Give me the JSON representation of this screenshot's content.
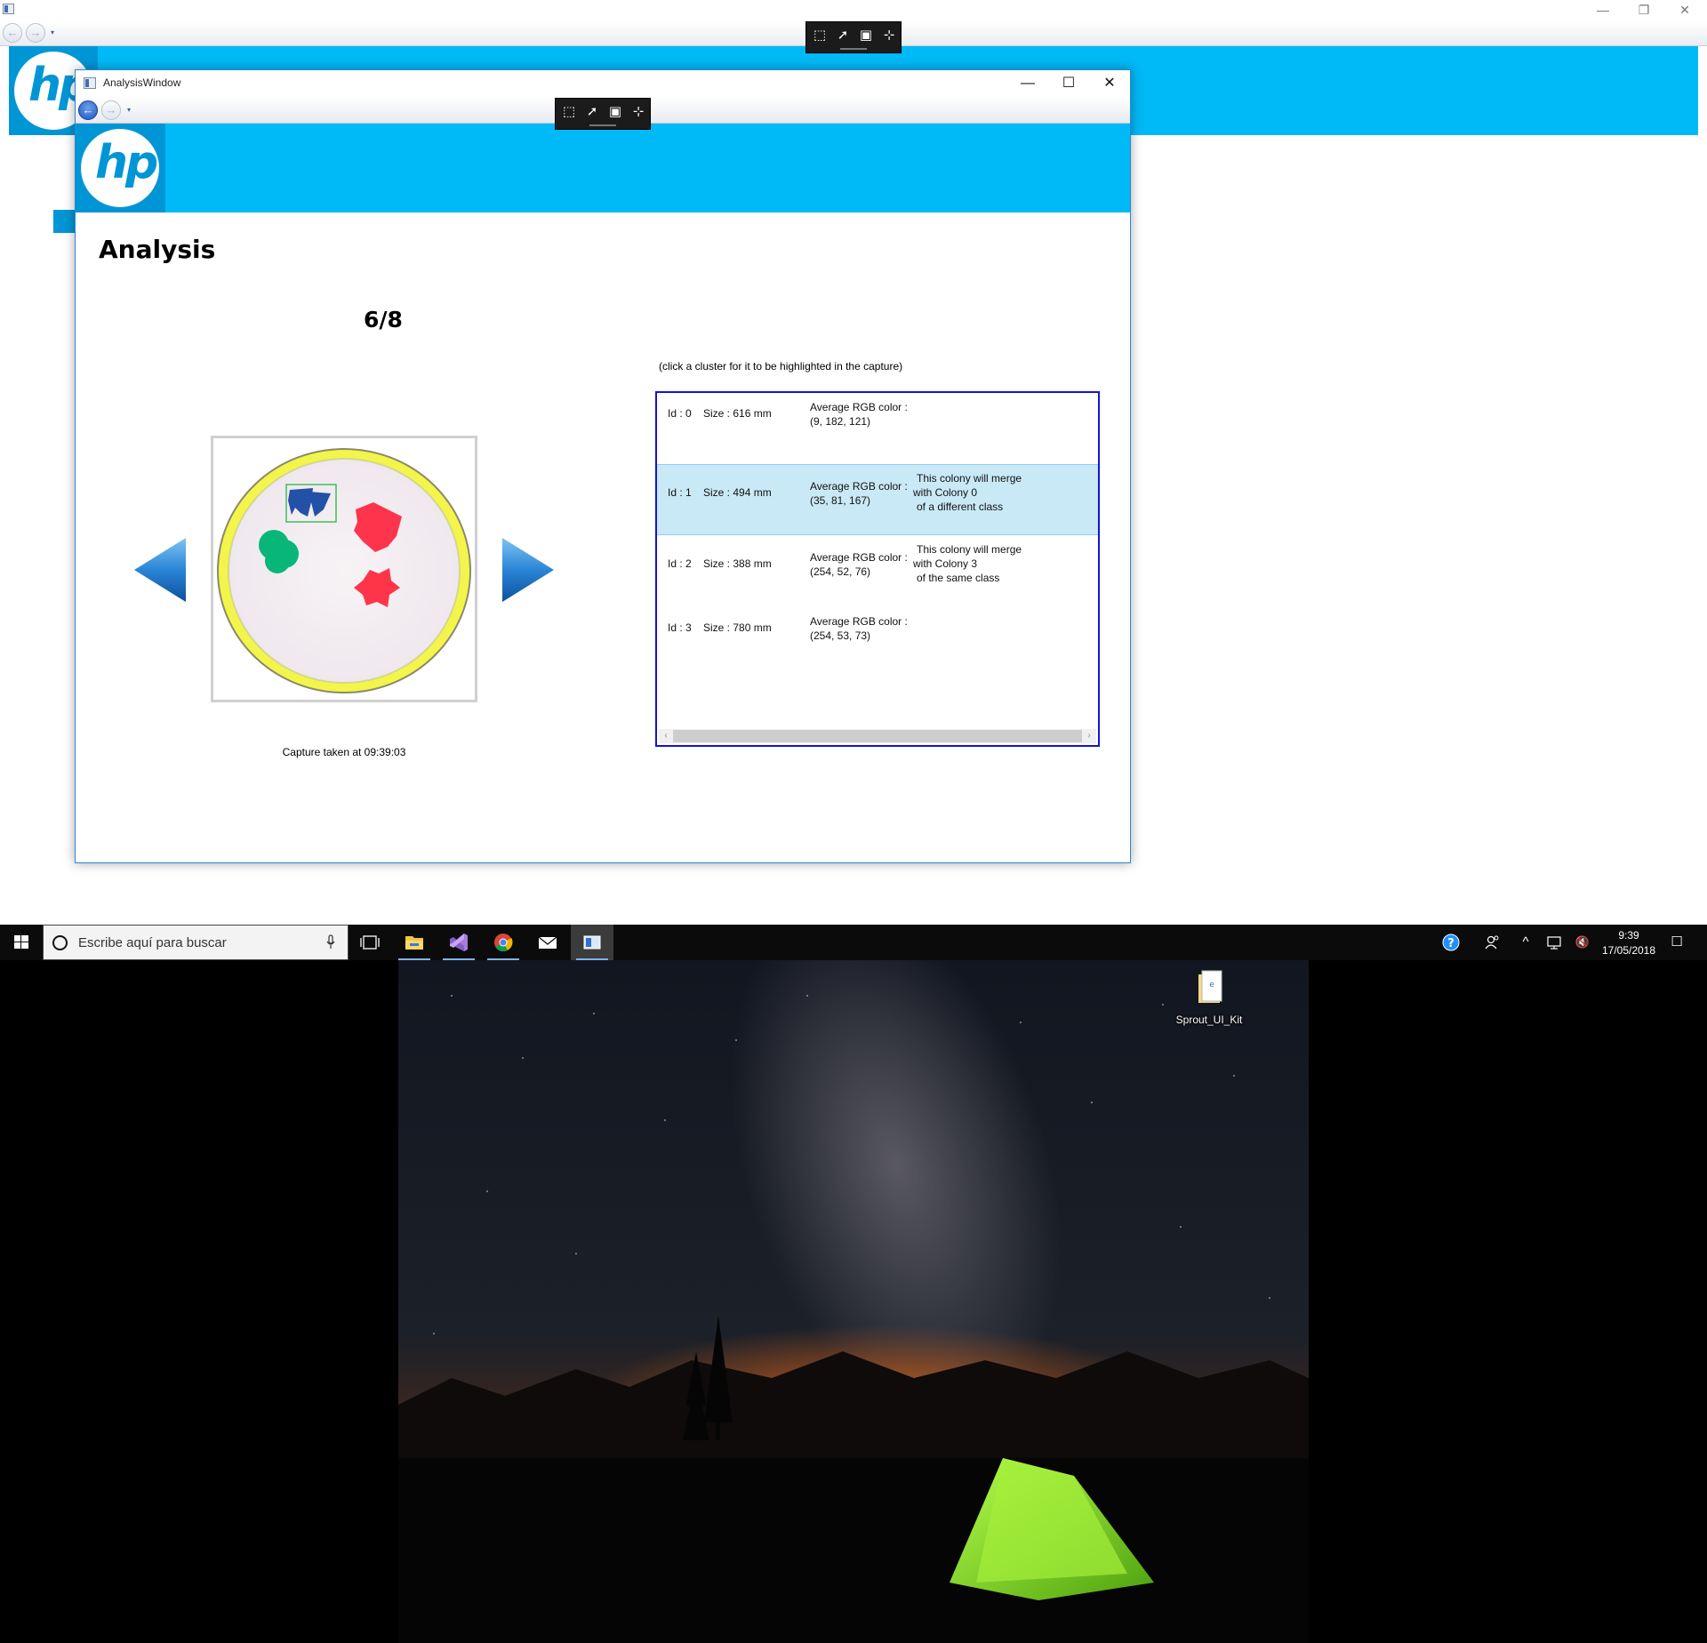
{
  "parent_window": {
    "nav": {
      "back_symbol": "←",
      "forward_symbol": "→",
      "dropdown_symbol": "▾"
    },
    "caption": {
      "minimize_symbol": "—",
      "restore_symbol": "❐",
      "close_symbol": "✕"
    },
    "logo_text": "hp"
  },
  "dev_toolbar": {
    "icons": [
      "select-element-icon",
      "display-layout-icon",
      "track-focused-element-icon",
      "adorner-icon"
    ]
  },
  "analysis_window": {
    "title": "AnalysisWindow",
    "caption": {
      "minimize_symbol": "—",
      "maximize_symbol": "☐",
      "close_symbol": "✕"
    },
    "nav": {
      "back_symbol": "←",
      "forward_symbol": "→",
      "dropdown_symbol": "▾"
    },
    "logo_text": "hp",
    "heading": "Analysis",
    "page_counter": "6/8",
    "capture_time": "Capture taken at 09:39:03",
    "cluster_hint": "(click a cluster for it to be highlighted in the capture)",
    "clusters": [
      {
        "id": "Id : 0",
        "size": "Size : 616 mm",
        "rgb_label": "Average RGB color :",
        "rgb_value": "(9, 182, 121)",
        "merge_line1": "",
        "merge_line2": "",
        "merge_line3": "",
        "selected": false
      },
      {
        "id": "Id : 1",
        "size": "Size : 494 mm",
        "rgb_label": "Average RGB color :",
        "rgb_value": "(35, 81, 167)",
        "merge_line1": "This colony will merge",
        "merge_line2": "with Colony 0",
        "merge_line3": "of a different class",
        "selected": true
      },
      {
        "id": "Id : 2",
        "size": "Size : 388 mm",
        "rgb_label": "Average RGB color :",
        "rgb_value": "(254, 52, 76)",
        "merge_line1": "This colony will merge",
        "merge_line2": "with Colony 3",
        "merge_line3": "of the same class",
        "selected": false
      },
      {
        "id": "Id : 3",
        "size": "Size : 780 mm",
        "rgb_label": "Average RGB color :",
        "rgb_value": "(254, 53, 73)",
        "merge_line1": "",
        "merge_line2": "",
        "merge_line3": "",
        "selected": false
      }
    ],
    "scroll": {
      "left_symbol": "‹",
      "right_symbol": "›"
    }
  },
  "taskbar": {
    "search_placeholder": "Escribe aquí para buscar",
    "pinned_apps": [
      "task-view-icon",
      "file-explorer-icon",
      "visual-studio-icon",
      "chrome-icon",
      "mail-icon",
      "running-app-icon"
    ],
    "tray_icons": [
      "help-icon",
      "people-icon",
      "show-hidden-icons-icon",
      "network-icon",
      "volume-muted-icon"
    ],
    "tray_symbols": {
      "show_hidden": "^",
      "volume": "🔇",
      "notifications": "☐"
    },
    "time": "9:39",
    "date": "17/05/2018"
  },
  "desktop": {
    "folder_label": "Sprout_UI_Kit"
  },
  "colors": {
    "hp_banner": "#00b9f7",
    "hp_logo_bg": "#0096d6",
    "window_border": "#2b87d3",
    "selected_row": "#c9e9f7",
    "list_border": "#1212d8",
    "taskbar": "#0b0b0b",
    "colony_green": "#09b679",
    "colony_blue": "#2351a7",
    "colony_red_a": "#fe344c",
    "colony_red_b": "#fe3549",
    "plate_rim": "#f3f54a"
  }
}
